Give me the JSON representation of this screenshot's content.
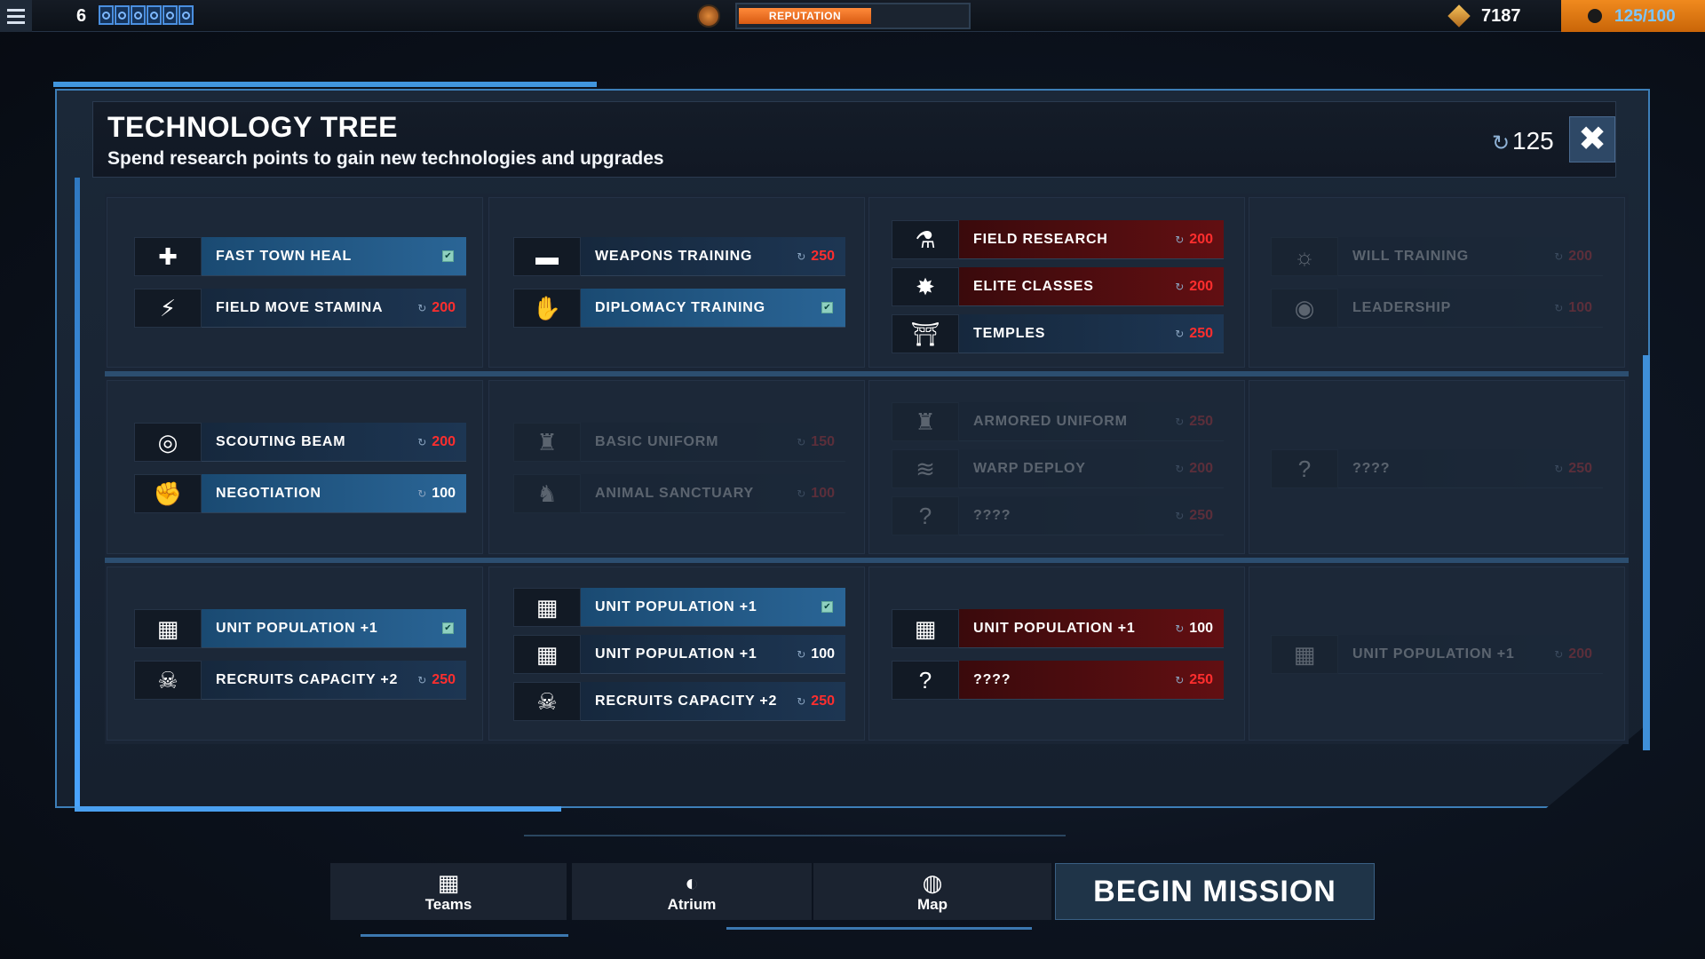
{
  "topbar": {
    "level": "6",
    "reputation_label": "REPUTATION",
    "reputation_progress": 0.58,
    "gold": "7187",
    "research": "125/100"
  },
  "panel": {
    "title": "TECHNOLOGY TREE",
    "subtitle": "Spend research points to gain new technologies and upgrades",
    "points": "125",
    "close_glyph": "✖"
  },
  "techs": {
    "fast_town_heal": {
      "name": "FAST TOWN HEAL",
      "cost": ""
    },
    "field_move_stamina": {
      "name": "FIELD MOVE STAMINA",
      "cost": "200"
    },
    "weapons_training": {
      "name": "WEAPONS TRAINING",
      "cost": "250"
    },
    "diplomacy_training": {
      "name": "DIPLOMACY TRAINING",
      "cost": ""
    },
    "field_research": {
      "name": "FIELD RESEARCH",
      "cost": "200"
    },
    "elite_classes": {
      "name": "ELITE CLASSES",
      "cost": "200"
    },
    "temples": {
      "name": "TEMPLES",
      "cost": "250"
    },
    "will_training": {
      "name": "WILL TRAINING",
      "cost": "200"
    },
    "leadership": {
      "name": "LEADERSHIP",
      "cost": "100"
    },
    "scouting_beam": {
      "name": "SCOUTING BEAM",
      "cost": "200"
    },
    "negotiation": {
      "name": "NEGOTIATION",
      "cost": "100"
    },
    "basic_uniform": {
      "name": "BASIC UNIFORM",
      "cost": "150"
    },
    "animal_sanctuary": {
      "name": "ANIMAL SANCTUARY",
      "cost": "100"
    },
    "armored_uniform": {
      "name": "ARMORED UNIFORM",
      "cost": "250"
    },
    "warp_deploy": {
      "name": "WARP DEPLOY",
      "cost": "200"
    },
    "unknown_r2c3": {
      "name": "????",
      "cost": "250"
    },
    "unknown_r2c4": {
      "name": "????",
      "cost": "250"
    },
    "unit_pop_r3c1": {
      "name": "UNIT POPULATION +1",
      "cost": ""
    },
    "recruits_r3c1": {
      "name": "RECRUITS CAPACITY +2",
      "cost": "250"
    },
    "unit_pop_r3c2a": {
      "name": "UNIT POPULATION +1",
      "cost": ""
    },
    "unit_pop_r3c2b": {
      "name": "UNIT POPULATION +1",
      "cost": "100"
    },
    "recruits_r3c2": {
      "name": "RECRUITS CAPACITY +2",
      "cost": "250"
    },
    "unit_pop_r3c3": {
      "name": "UNIT POPULATION +1",
      "cost": "100"
    },
    "unknown_r3c3": {
      "name": "????",
      "cost": "250"
    },
    "unit_pop_r3c4": {
      "name": "UNIT POPULATION +1",
      "cost": "200"
    }
  },
  "nav": {
    "teams": "Teams",
    "atrium": "Atrium",
    "map": "Map",
    "begin": "BEGIN MISSION"
  }
}
